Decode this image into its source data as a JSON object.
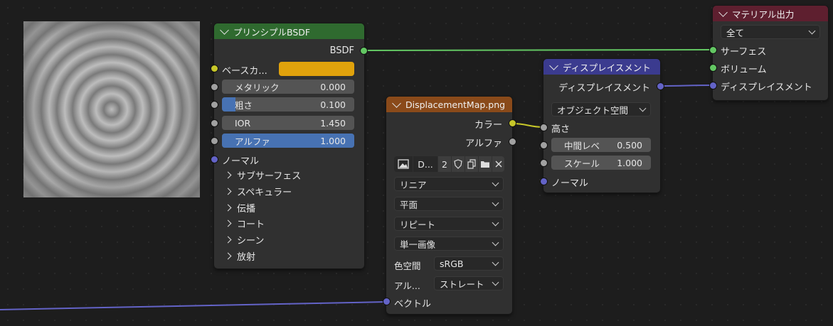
{
  "colors": {
    "principled_header": "#2f6a2f",
    "image_header": "#8a4a1a",
    "displacement_header": "#3b3b8f",
    "output_header": "#5e1f2f",
    "accent": "#4772b3",
    "base_color_swatch": "#e0a20c"
  },
  "preview": {
    "name": "texture-preview"
  },
  "principled": {
    "title": "プリンシプルBSDF",
    "output_bsdf": "BSDF",
    "base_color": "ベースカ...",
    "metallic": {
      "label": "メタリック",
      "value": "0.000",
      "fraction": 0.0
    },
    "roughness": {
      "label": "粗さ",
      "value": "0.100",
      "fraction": 0.1
    },
    "ior": {
      "label": "IOR",
      "value": "1.450",
      "fraction": 0.0
    },
    "alpha": {
      "label": "アルファ",
      "value": "1.000",
      "fraction": 1.0
    },
    "normal": "ノーマル",
    "panels": [
      "サブサーフェス",
      "スペキュラー",
      "伝播",
      "コート",
      "シーン",
      "放射"
    ]
  },
  "image": {
    "title": "DisplacementMap.png",
    "out_color": "カラー",
    "out_alpha": "アルファ",
    "image_name": "D...",
    "users": "2",
    "interpolation": "リニア",
    "projection": "平面",
    "extension": "リピート",
    "source": "単一画像",
    "colorspace_label": "色空間",
    "colorspace": "sRGB",
    "alpha_label": "アル...",
    "alpha_mode": "ストレート",
    "vector": "ベクトル"
  },
  "displacement": {
    "title": "ディスプレイスメント",
    "output": "ディスプレイスメント",
    "space": "オブジェクト空間",
    "height": "高さ",
    "midlevel": {
      "label": "中間レベ",
      "value": "0.500"
    },
    "scale": {
      "label": "スケール",
      "value": "1.000"
    },
    "normal": "ノーマル"
  },
  "output": {
    "title": "マテリアル出力",
    "target": "全て",
    "surface": "サーフェス",
    "volume": "ボリューム",
    "displacement": "ディスプレイスメント"
  }
}
